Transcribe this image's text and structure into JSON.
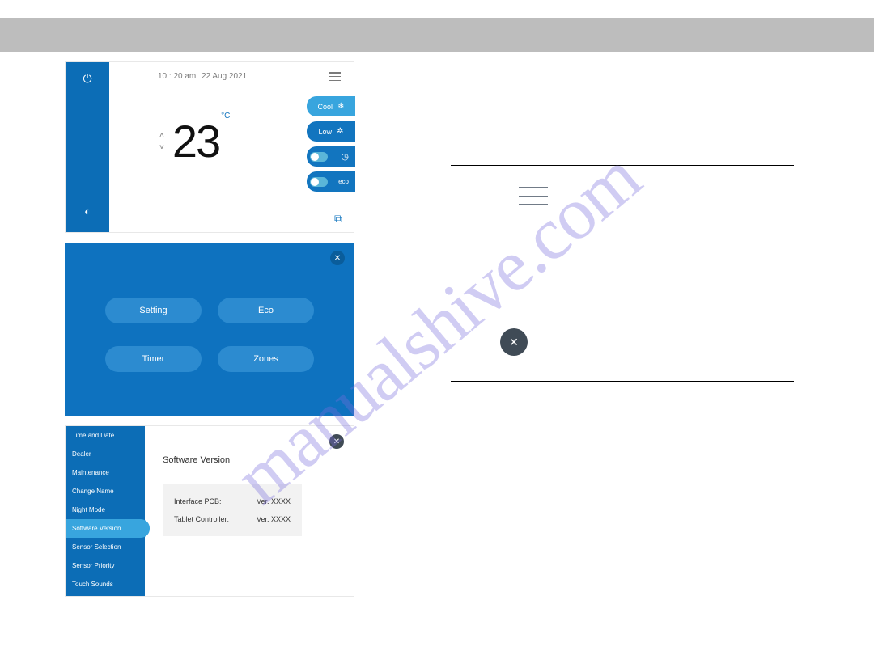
{
  "home": {
    "time": "10 : 20 am",
    "date": "22 Aug 2021",
    "temperature": "23",
    "unit": "°C",
    "mode_label": "Cool",
    "fan_label": "Low",
    "eco_label": "eco"
  },
  "settings_menu": {
    "items": [
      "Setting",
      "Eco",
      "Timer",
      "Zones"
    ]
  },
  "sidebar": {
    "items": [
      "Time and Date",
      "Dealer",
      "Maintenance",
      "Change Name",
      "Night Mode",
      "Software Version",
      "Sensor Selection",
      "Sensor Priority",
      "Touch Sounds"
    ],
    "active_index": 5
  },
  "software_version": {
    "title": "Software Version",
    "rows": [
      {
        "label": "Interface PCB:",
        "value": "Ver. XXXX"
      },
      {
        "label": "Tablet Controller:",
        "value": "Ver. XXXX"
      }
    ]
  },
  "watermark": "manualshive.com"
}
